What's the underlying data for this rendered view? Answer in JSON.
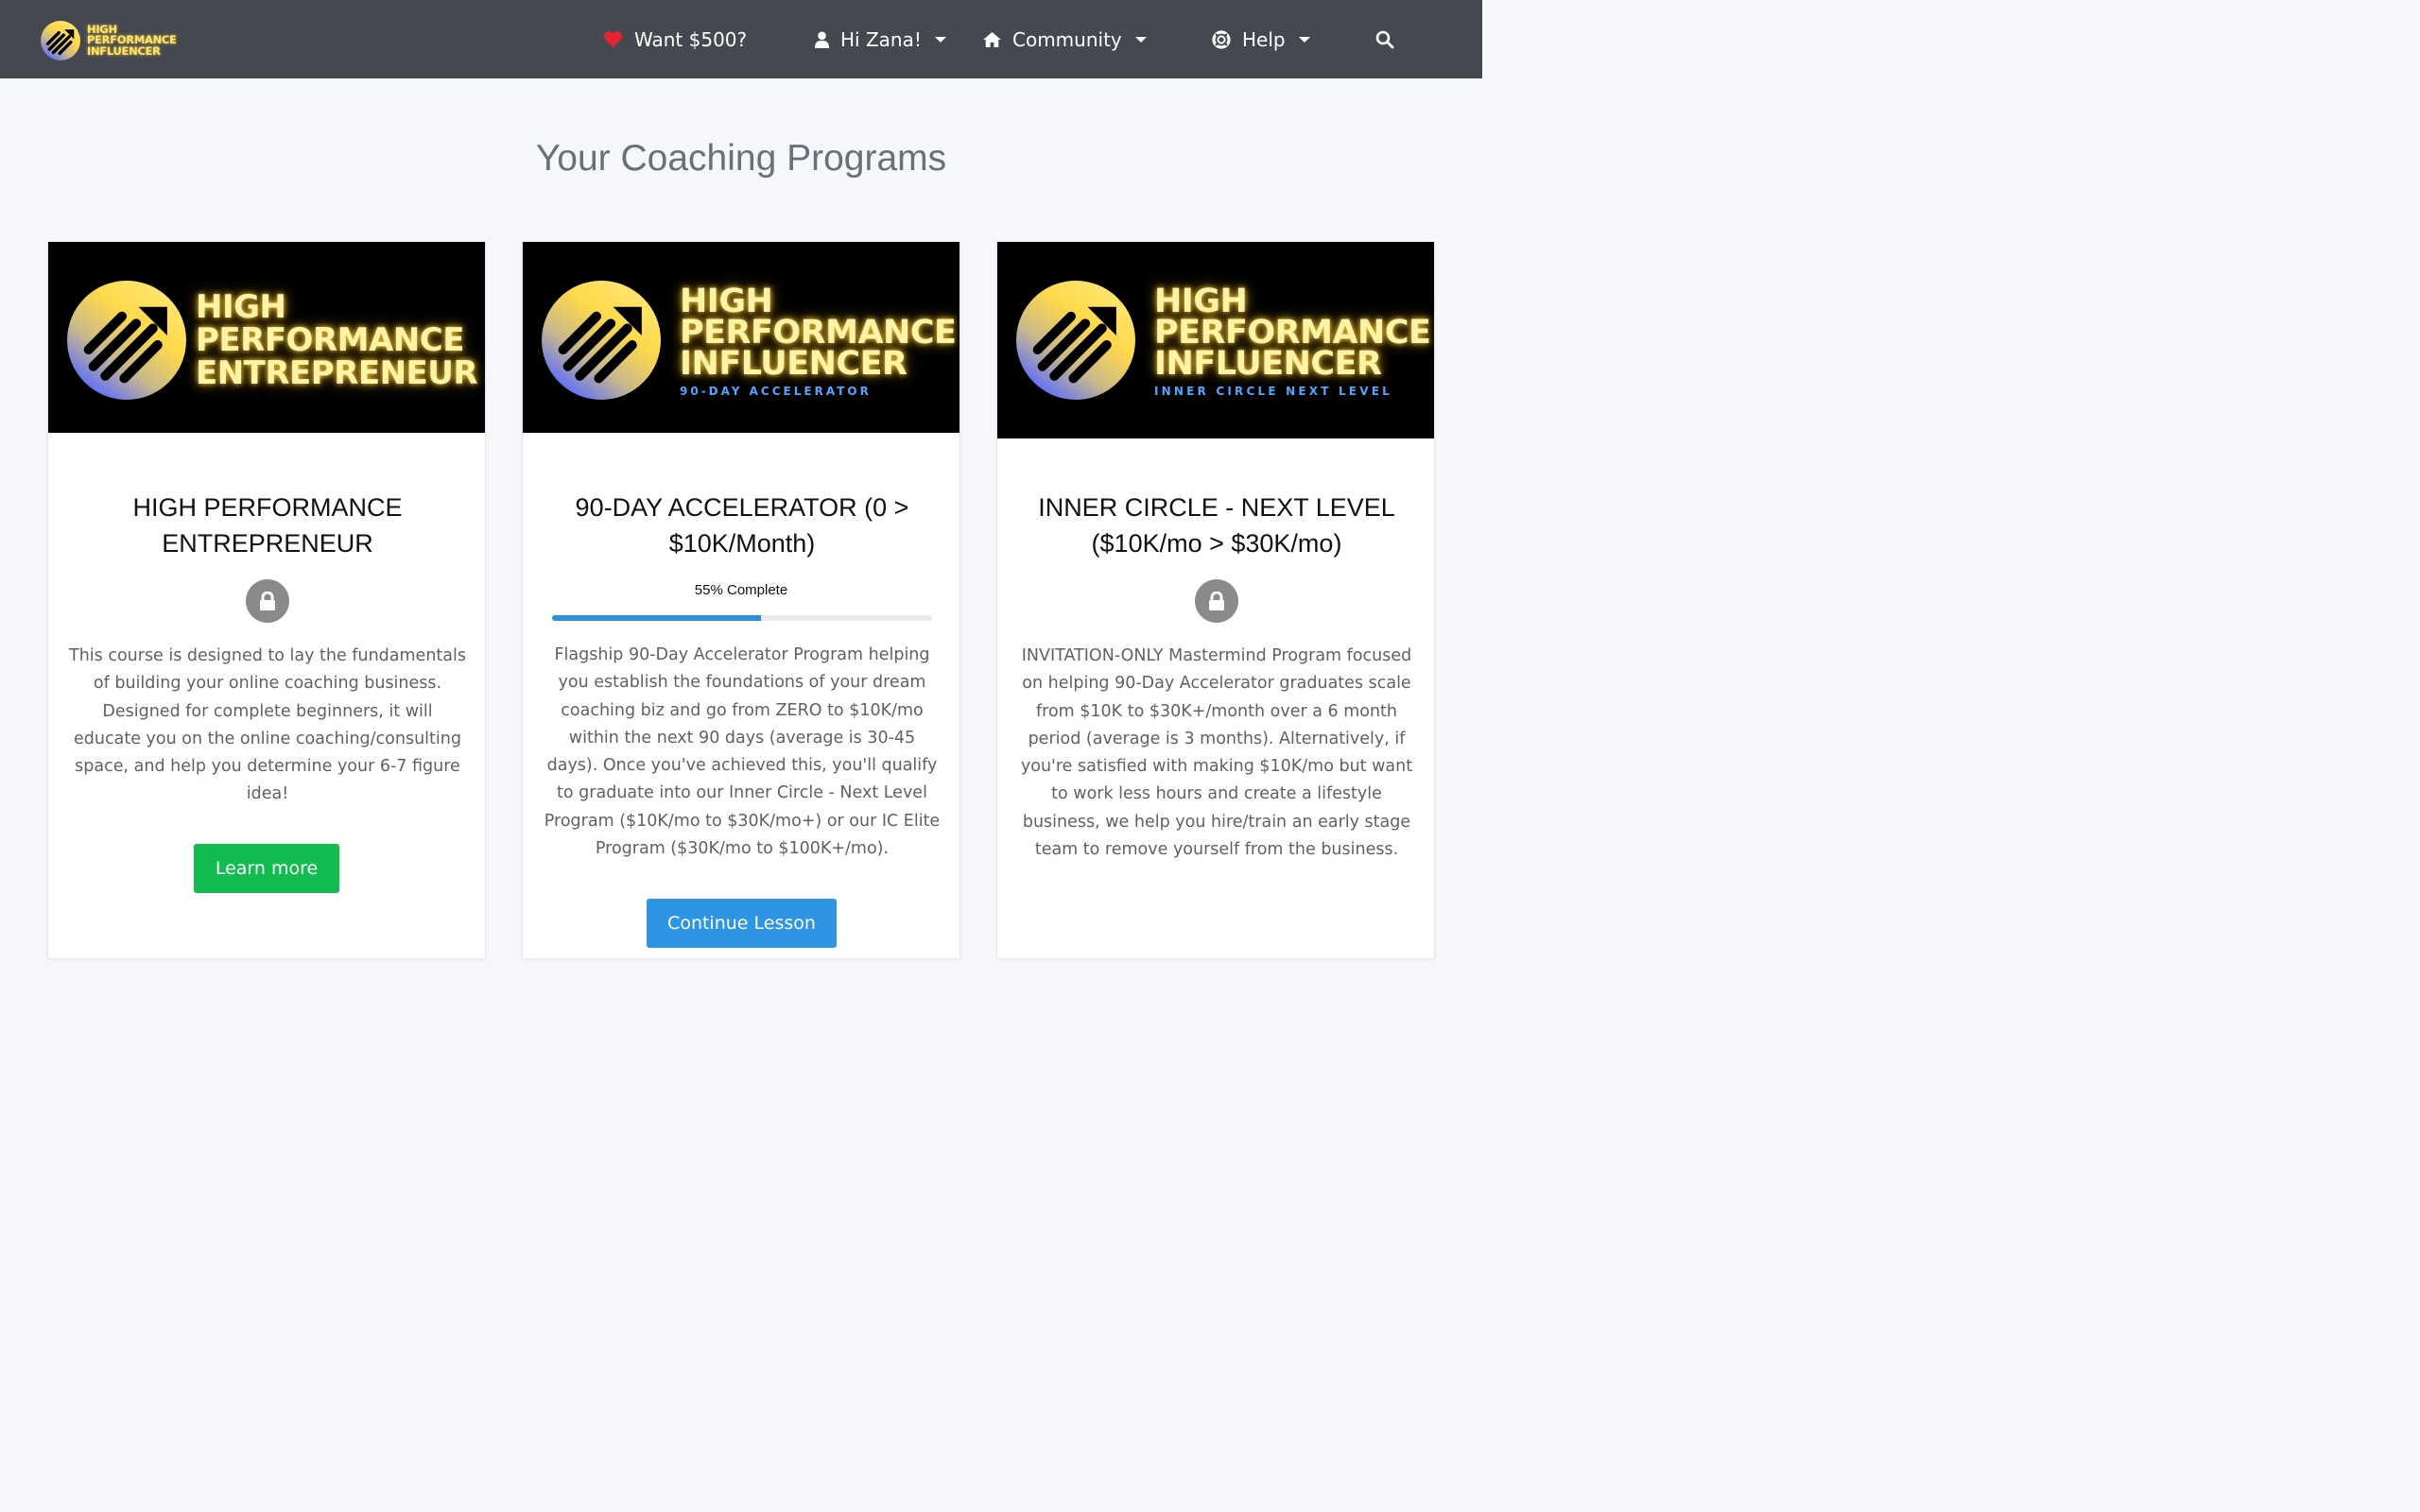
{
  "navbar": {
    "logo_lines": [
      "HIGH",
      "PERFORMANCE",
      "INFLUENCER"
    ],
    "referral_label": "Want $500?",
    "user_label": "Hi Zana!",
    "community_label": "Community",
    "help_label": "Help"
  },
  "page_title": "Your Coaching Programs",
  "cards": [
    {
      "banner_lines": [
        "HIGH",
        "PERFORMANCE",
        "ENTREPRENEUR"
      ],
      "banner_subtitle": "",
      "title": "HIGH PERFORMANCE ENTREPRENEUR",
      "locked": true,
      "description": "This course is designed to lay the fundamentals of building your online coaching business. Designed for complete beginners, it will educate you on the online coaching/consulting space, and help you determine your 6-7 figure idea!",
      "button_label": "Learn more"
    },
    {
      "banner_lines": [
        "HIGH",
        "PERFORMANCE",
        "INFLUENCER"
      ],
      "banner_subtitle": "90-DAY ACCELERATOR",
      "title": "90-DAY ACCELERATOR (0 > $10K/Month)",
      "progress_label": "55% Complete",
      "progress_percent": 55,
      "description": "Flagship 90-Day Accelerator Program helping you establish the foundations of your dream coaching biz and go from ZERO to $10K/mo within the next 90 days (average is 30-45 days). Once you've achieved this, you'll qualify to graduate into our Inner Circle - Next Level Program ($10K/mo to $30K/mo+) or our IC Elite Program ($30K/mo to $100K+/mo).",
      "button_label": "Continue Lesson"
    },
    {
      "banner_lines": [
        "HIGH",
        "PERFORMANCE",
        "INFLUENCER"
      ],
      "banner_subtitle": "INNER CIRCLE NEXT LEVEL",
      "title": "INNER CIRCLE - NEXT LEVEL ($10K/mo > $30K/mo)",
      "locked": true,
      "description": "INVITATION-ONLY Mastermind Program focused on helping 90-Day Accelerator graduates scale from $10K to $30K+/month over a 6 month period (average is 3 months). Alternatively, if you're satisfied with making $10K/mo but want to work less hours and create a lifestyle business, we help you hire/train an early stage team to remove yourself from the business."
    }
  ],
  "colors": {
    "navbar_bg": "#45484f",
    "page_bg": "#f6f7fa",
    "learn_more_btn": "#11bd4e",
    "continue_btn": "#2e95e5",
    "progress_fill": "#2e8fdc",
    "heart": "#e8232f",
    "logo_glow": "#ffe66b",
    "banner_subtitle": "#4ea7ff"
  },
  "icons": {
    "logo": "trending-arrow-stripes-logo",
    "referral": "heart-icon",
    "user": "user-icon",
    "community": "home-icon",
    "help": "life-ring-icon",
    "search": "search-icon",
    "locked": "lock-icon"
  }
}
